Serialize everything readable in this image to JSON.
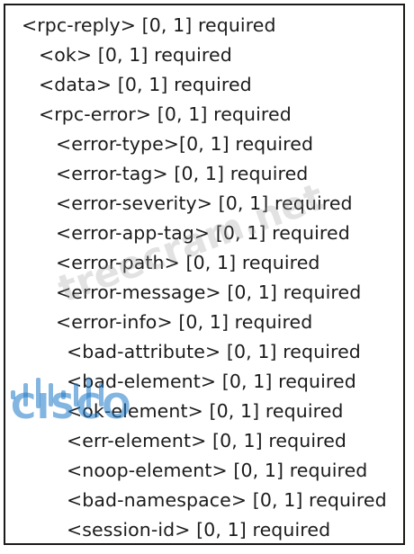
{
  "lines": [
    "<rpc-reply> [0, 1] required",
    "<ok> [0, 1] required",
    "<data> [0, 1] required",
    "<rpc-error> [0, 1] required",
    "<error-type>[0, 1] required",
    "<error-tag> [0, 1] required",
    "<error-severity> [0, 1] required",
    "<error-app-tag> [0, 1] required",
    "<error-path> [0, 1] required",
    "<error-message> [0, 1] required",
    "<error-info> [0, 1] required",
    "<bad-attribute> [0, 1] required",
    "<bad-element> [0, 1] required",
    "<ok-element> [0, 1] required",
    "<err-element> [0, 1] required",
    "<noop-element> [0, 1] required",
    "<bad-namespace> [0, 1] required",
    "<session-id> [0, 1] required"
  ],
  "watermark": {
    "text": "treecram.net",
    "logo_word": "CISCO",
    "logo_color": "#1e78c8"
  }
}
